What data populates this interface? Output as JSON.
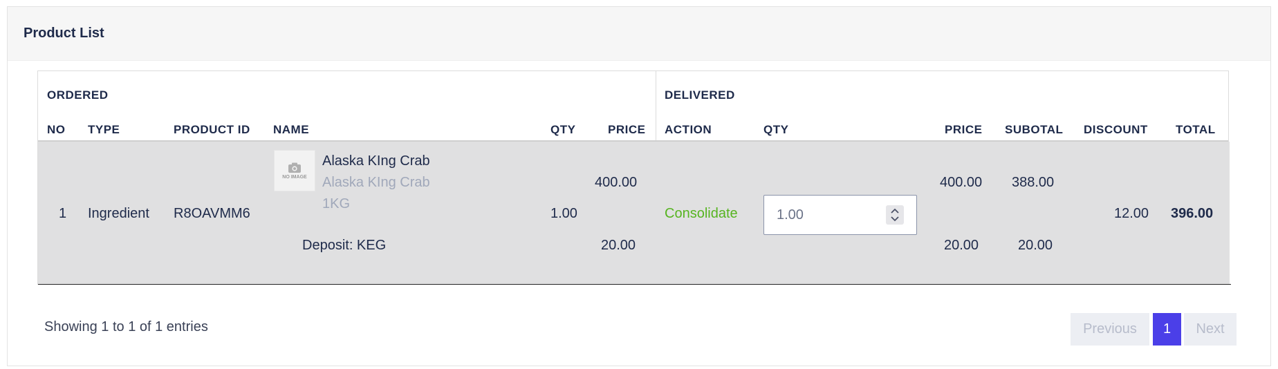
{
  "card": {
    "title": "Product List"
  },
  "table": {
    "group_ordered": "ORDERED",
    "group_delivered": "DELIVERED",
    "headers": {
      "no": "NO",
      "type": "TYPE",
      "product_id": "PRODUCT ID",
      "name": "NAME",
      "qty": "QTY",
      "price": "PRICE",
      "action": "ACTION",
      "del_qty": "QTY",
      "del_price": "PRICE",
      "subtotal": "SUBOTAL",
      "discount": "DISCOUNT",
      "total": "TOTAL"
    },
    "row": {
      "no": "1",
      "type": "Ingredient",
      "product_id": "R8OAVMM6",
      "thumb_text": "NO IMAGE",
      "name": "Alaska KIng Crab",
      "name_sub": "Alaska KIng Crab",
      "unit": "1KG",
      "deposit": "Deposit: KEG",
      "qty": "1.00",
      "price": "400.00",
      "deposit_price": "20.00",
      "action": "Consolidate",
      "del_qty_value": "1.00",
      "del_price": "400.00",
      "del_deposit_price": "20.00",
      "subtotal": "388.00",
      "deposit_subtotal": "20.00",
      "discount": "12.00",
      "total": "396.00"
    }
  },
  "footer": {
    "info": "Showing 1 to 1 of 1 entries",
    "prev": "Previous",
    "page": "1",
    "next": "Next"
  },
  "icons": {
    "thumb": "camera-icon",
    "spinner": "stepper-arrows-icon"
  },
  "colors": {
    "action_green": "#56b420",
    "pager_active": "#4b3fe8",
    "row_bg": "#e0e0e1"
  }
}
